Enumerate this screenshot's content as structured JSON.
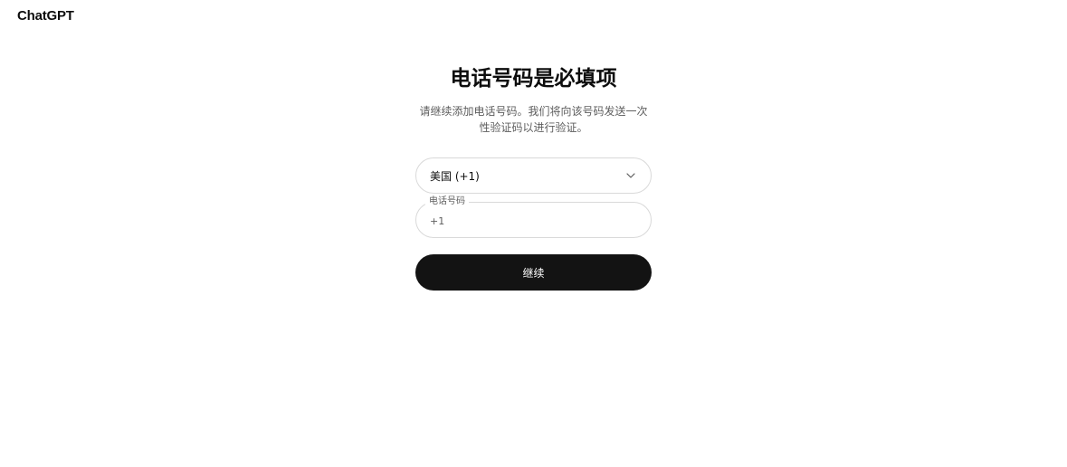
{
  "header": {
    "logo_text": "ChatGPT"
  },
  "main": {
    "title": "电话号码是必填项",
    "subtitle": "请继续添加电话号码。我们将向该号码发送一次性验证码以进行验证。"
  },
  "country_select": {
    "value": "美国 (+1)",
    "icon": "chevron-down-icon"
  },
  "phone_field": {
    "label": "电话号码",
    "value": "+1"
  },
  "continue_button": {
    "label": "继续"
  },
  "colors": {
    "button_bg": "#131313",
    "button_text": "#ffffff",
    "border": "#d9d9d9",
    "muted_text": "#5d5d5d"
  }
}
